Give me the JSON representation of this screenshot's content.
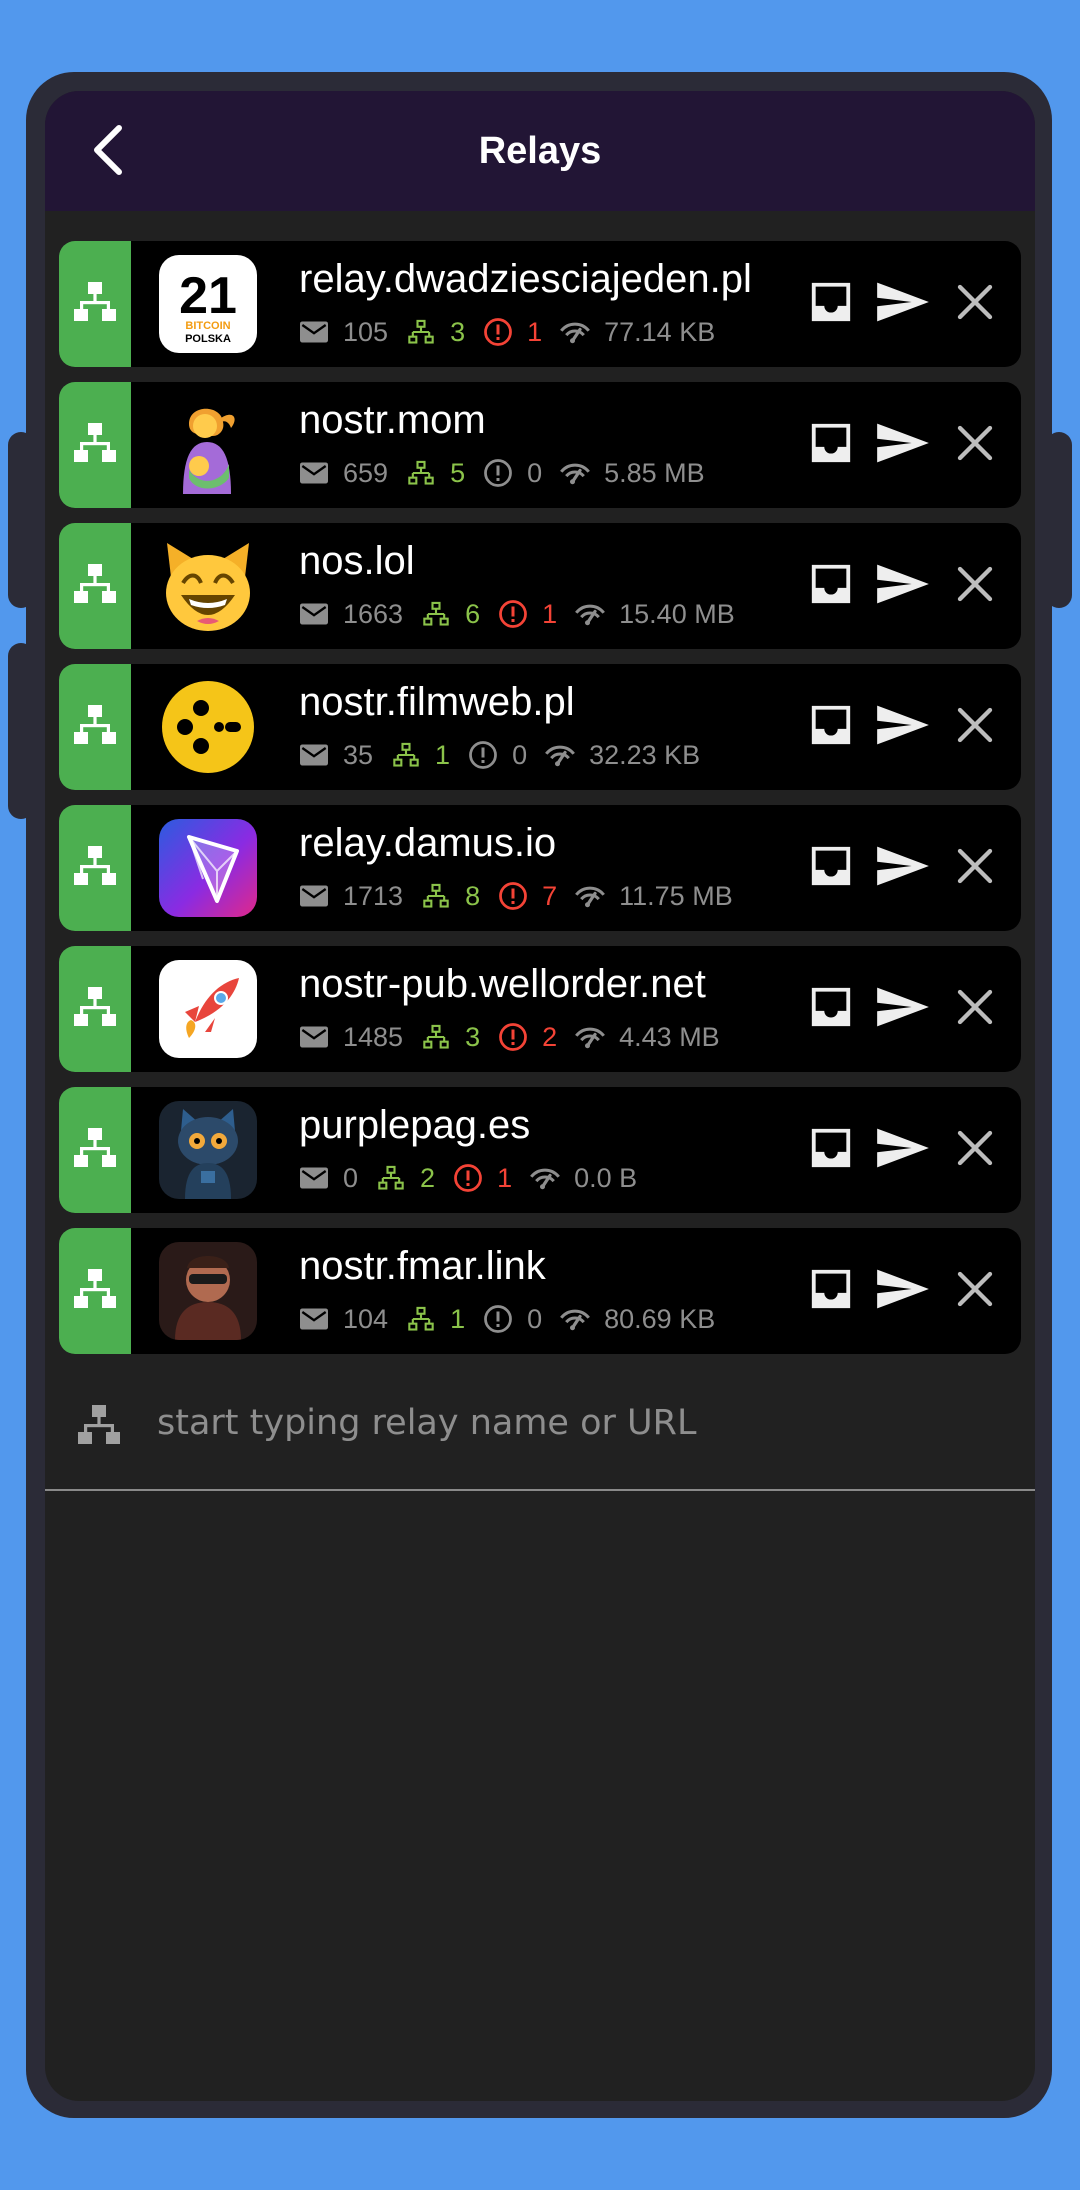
{
  "header": {
    "title": "Relays"
  },
  "relays": [
    {
      "name": "relay.dwadziesciajeden.pl",
      "messages": "105",
      "connections": "3",
      "errors": "1",
      "bandwidth": "77.14 KB",
      "has_errors": true,
      "icon": "bitcoin-polska-logo"
    },
    {
      "name": "nostr.mom",
      "messages": "659",
      "connections": "5",
      "errors": "0",
      "bandwidth": "5.85 MB",
      "has_errors": false,
      "icon": "breastfeeding-emoji"
    },
    {
      "name": "nos.lol",
      "messages": "1663",
      "connections": "6",
      "errors": "1",
      "bandwidth": "15.40 MB",
      "has_errors": true,
      "icon": "laughing-cat-emoji"
    },
    {
      "name": "nostr.filmweb.pl",
      "messages": "35",
      "connections": "1",
      "errors": "0",
      "bandwidth": "32.23 KB",
      "has_errors": false,
      "icon": "filmweb-logo"
    },
    {
      "name": "relay.damus.io",
      "messages": "1713",
      "connections": "8",
      "errors": "7",
      "bandwidth": "11.75 MB",
      "has_errors": true,
      "icon": "damus-logo"
    },
    {
      "name": "nostr-pub.wellorder.net",
      "messages": "1485",
      "connections": "3",
      "errors": "2",
      "bandwidth": "4.43 MB",
      "has_errors": true,
      "icon": "rocket-logo"
    },
    {
      "name": "purplepag.es",
      "messages": "0",
      "connections": "2",
      "errors": "1",
      "bandwidth": "0.0 B",
      "has_errors": true,
      "icon": "robot-cat-avatar"
    },
    {
      "name": "nostr.fmar.link",
      "messages": "104",
      "connections": "1",
      "errors": "0",
      "bandwidth": "80.69 KB",
      "has_errors": false,
      "icon": "person-avatar"
    }
  ],
  "add_relay": {
    "placeholder": "start typing relay name or URL"
  },
  "logo": {
    "top": "21",
    "mid": "BITCOIN",
    "bottom": "POLSKA"
  },
  "colors": {
    "background": "#5298ED",
    "appbar": "#221535",
    "screen": "#212121",
    "row": "#000000",
    "accent_green": "#4CAF50",
    "stat_green": "#8BC34A",
    "error_red": "#F44336",
    "muted_text": "#8E8E8E"
  }
}
